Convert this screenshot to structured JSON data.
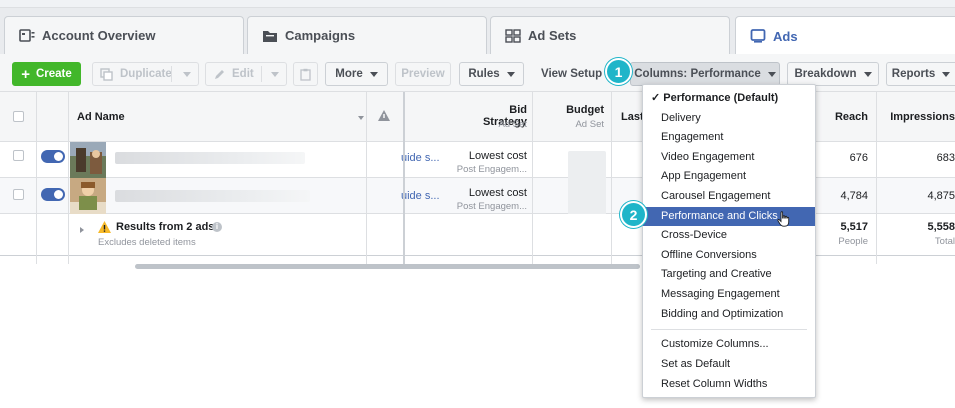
{
  "tabs": [
    {
      "label": "Account Overview",
      "icon": "account-overview-icon"
    },
    {
      "label": "Campaigns",
      "icon": "folder-icon"
    },
    {
      "label": "Ad Sets",
      "icon": "grid-icon"
    },
    {
      "label": "Ads",
      "icon": "ad-icon",
      "active": true
    }
  ],
  "toolbar": {
    "create": "Create",
    "duplicate": "Duplicate",
    "edit": "Edit",
    "more": "More",
    "preview": "Preview",
    "rules": "Rules",
    "view_setup": "View Setup",
    "columns": "Columns: Performance",
    "breakdown": "Breakdown",
    "reports": "Reports"
  },
  "steps": {
    "one": "1",
    "two": "2"
  },
  "table": {
    "headers": {
      "ad_name": "Ad Name",
      "bid_strategy": "Bid Strategy",
      "bid_strategy_sub": "Ad Set",
      "budget": "Budget",
      "budget_sub": "Ad Set",
      "last": "Last",
      "reach": "Reach",
      "impressions": "Impressions"
    },
    "rows": [
      {
        "link": "uide s...",
        "bid": "Lowest cost",
        "bid_sub": "Post Engagem...",
        "reach": "676",
        "impressions": "683"
      },
      {
        "link": "uide s...",
        "bid": "Lowest cost",
        "bid_sub": "Post Engagem...",
        "reach": "4,784",
        "impressions": "4,875"
      }
    ],
    "summary": {
      "title": "Results from 2 ads",
      "subtitle": "Excludes deleted items",
      "reach": "5,517",
      "reach_sub": "People",
      "impressions": "5,558",
      "impressions_sub": "Total"
    }
  },
  "menu": {
    "items": [
      {
        "label": "Performance (Default)",
        "selected": true
      },
      {
        "label": "Delivery"
      },
      {
        "label": "Engagement"
      },
      {
        "label": "Video Engagement"
      },
      {
        "label": "App Engagement"
      },
      {
        "label": "Carousel Engagement"
      },
      {
        "label": "Performance and Clicks",
        "highlighted": true
      },
      {
        "label": "Cross-Device"
      },
      {
        "label": "Offline Conversions"
      },
      {
        "label": "Targeting and Creative"
      },
      {
        "label": "Messaging Engagement"
      },
      {
        "label": "Bidding and Optimization"
      }
    ],
    "footer_items": [
      {
        "label": "Customize Columns..."
      },
      {
        "label": "Set as Default"
      },
      {
        "label": "Reset Column Widths"
      }
    ]
  },
  "colors": {
    "accent": "#4267b2",
    "create": "#42b72a",
    "badge": "#1fb5c9"
  }
}
